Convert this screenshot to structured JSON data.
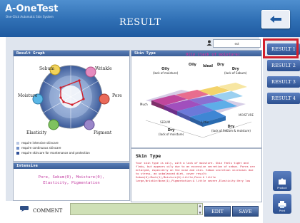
{
  "header": {
    "brand": "A-OneTest",
    "brand_sub": "One-Click Automatic Skin System",
    "title": "RESULT"
  },
  "user": {
    "name": "est"
  },
  "result_graph": {
    "title": "Result Graph",
    "axes": [
      "Sebum",
      "Wrinkle",
      "Pore",
      "Pigment",
      "Elasticity",
      "Moisture"
    ],
    "legend": [
      {
        "label": "require intensive skincare",
        "color": "#b7c6e3"
      },
      {
        "label": "require continuous skincare",
        "color": "#6f8ec7"
      },
      {
        "label": "require skincare for mantenance and protection",
        "color": "#2f4f97"
      }
    ]
  },
  "intensive": {
    "title": "Intensive",
    "line1": "Pore, Sebum(0), Moisture(0),",
    "line2": "Elasticity, Pigmentation"
  },
  "skin_type": {
    "title": "Skin Type",
    "result_label": "Oily (lack of moisture)",
    "map_labels": {
      "oily_lack_moisture": "Oily",
      "oily_lack_moisture_sub": "(lack of moisture)",
      "oily": "Oily",
      "ideal": "Ideal",
      "dry": "Dry",
      "dry_lack_sebum": "Dry",
      "dry_lack_sebum_sub": "(lack of Sebum)",
      "much": "Much",
      "sebum": "SEBUM",
      "little": "Little",
      "moisture": "MOISTURE",
      "dry_bottom": "Dry",
      "dry_bottom_sub": "(lack of Sebum & moisture)",
      "dry_left": "Dry",
      "dry_left_sub": "(lack of moisture)",
      "much_left": "Much",
      "little_bottom": "Little"
    }
  },
  "skin_type_text": {
    "heading": "Skin Type",
    "description": "Your skin type is oily, with a lack of moisture. Skin feels tight and flaky, but appears oily due to an excessive secretion of sebum. Pores are enlarged, especially on the nose and chin. Sebum secretion increases due to stress, an unbalanced diet, cover result: Sebum(0):Much(1),Moisture(0):Little,Pore:A little large,Wrinkle:None(1),Pigmentation:A little severe,Elasticity:Very low"
  },
  "comment": {
    "label": "COMMENT",
    "value": ""
  },
  "buttons": {
    "edit": "EDIT",
    "save": "SAVE",
    "product": "Product",
    "print": "Print"
  },
  "result_tabs": [
    "RESULT 1",
    "RESULT 2",
    "RESULT 3",
    "RESULT 4"
  ],
  "colors": {
    "header": "#2f6fb4",
    "accent_red": "#d21f2b",
    "intensive_text": "#c23aa0",
    "desc_text": "#d0223b"
  }
}
